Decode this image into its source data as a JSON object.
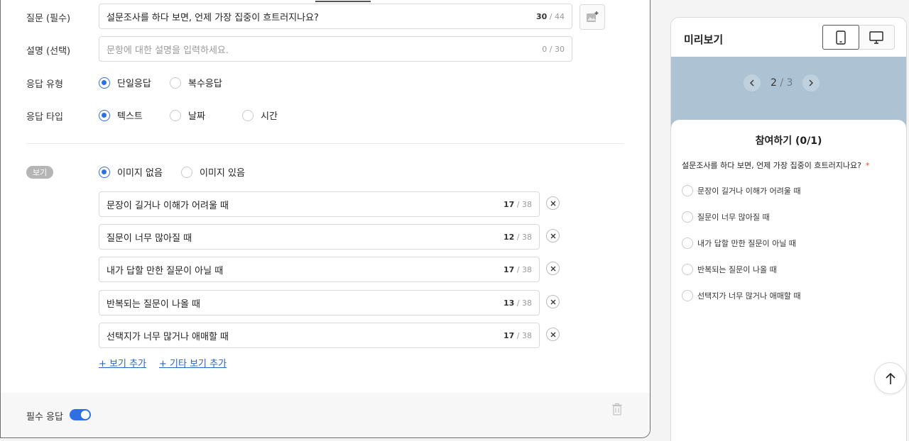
{
  "editor": {
    "question_label": "질문 (필수)",
    "question_value": "설문조사를 하다 보면, 언제 가장 집중이 흐트러지나요?",
    "question_count": "30",
    "question_max": " / 44",
    "desc_label": "설명 (선택)",
    "desc_placeholder": "문항에 대한 설명을 입력하세요.",
    "desc_count": "0 / 30",
    "answer_type_label": "응답 유형",
    "answer_types": [
      "단일응답",
      "복수응답"
    ],
    "answer_kind_label": "응답 타입",
    "answer_kinds": [
      "텍스트",
      "날짜",
      "시간"
    ],
    "options_badge": "보기",
    "image_modes": [
      "이미지 없음",
      "이미지 있음"
    ],
    "options": [
      {
        "text": "문장이 길거나 이해가 어려울 때",
        "count": "17",
        "max": " / 38"
      },
      {
        "text": "질문이 너무 많아질 때",
        "count": "12",
        "max": " / 38"
      },
      {
        "text": "내가 답할 만한 질문이 아닐 때",
        "count": "17",
        "max": " / 38"
      },
      {
        "text": "반복되는 질문이 나올 때",
        "count": "13",
        "max": " / 38"
      },
      {
        "text": "선택지가 너무 많거나 애매할 때",
        "count": "17",
        "max": " / 38"
      }
    ],
    "add_option": "+ 보기 추가",
    "add_other_option": "+ 기타 보기 추가",
    "required_label": "필수 응답",
    "required_on": true
  },
  "preview": {
    "title": "미리보기",
    "page_current": "2",
    "page_total": " / 3",
    "heading": "참여하기 (0/1)",
    "question": "설문조사를 하다 보면, 언제 가장 집중이 흐트러지나요?",
    "required_mark": "*",
    "options": [
      "문장이 길거나 이해가 어려울 때",
      "질문이 너무 많아질 때",
      "내가 답할 만한 질문이 아닐 때",
      "반복되는 질문이 나올 때",
      "선택지가 너무 많거나 애매할 때"
    ]
  },
  "colors": {
    "accent": "#2f6fe4",
    "link": "#2962c8",
    "banner": "#adc3d3",
    "required": "#e0452c"
  },
  "icons": [
    "add-image-icon",
    "close-icon",
    "trash-icon",
    "mobile-icon",
    "desktop-icon",
    "chevron-left-icon",
    "chevron-right-icon",
    "arrow-up-icon"
  ]
}
